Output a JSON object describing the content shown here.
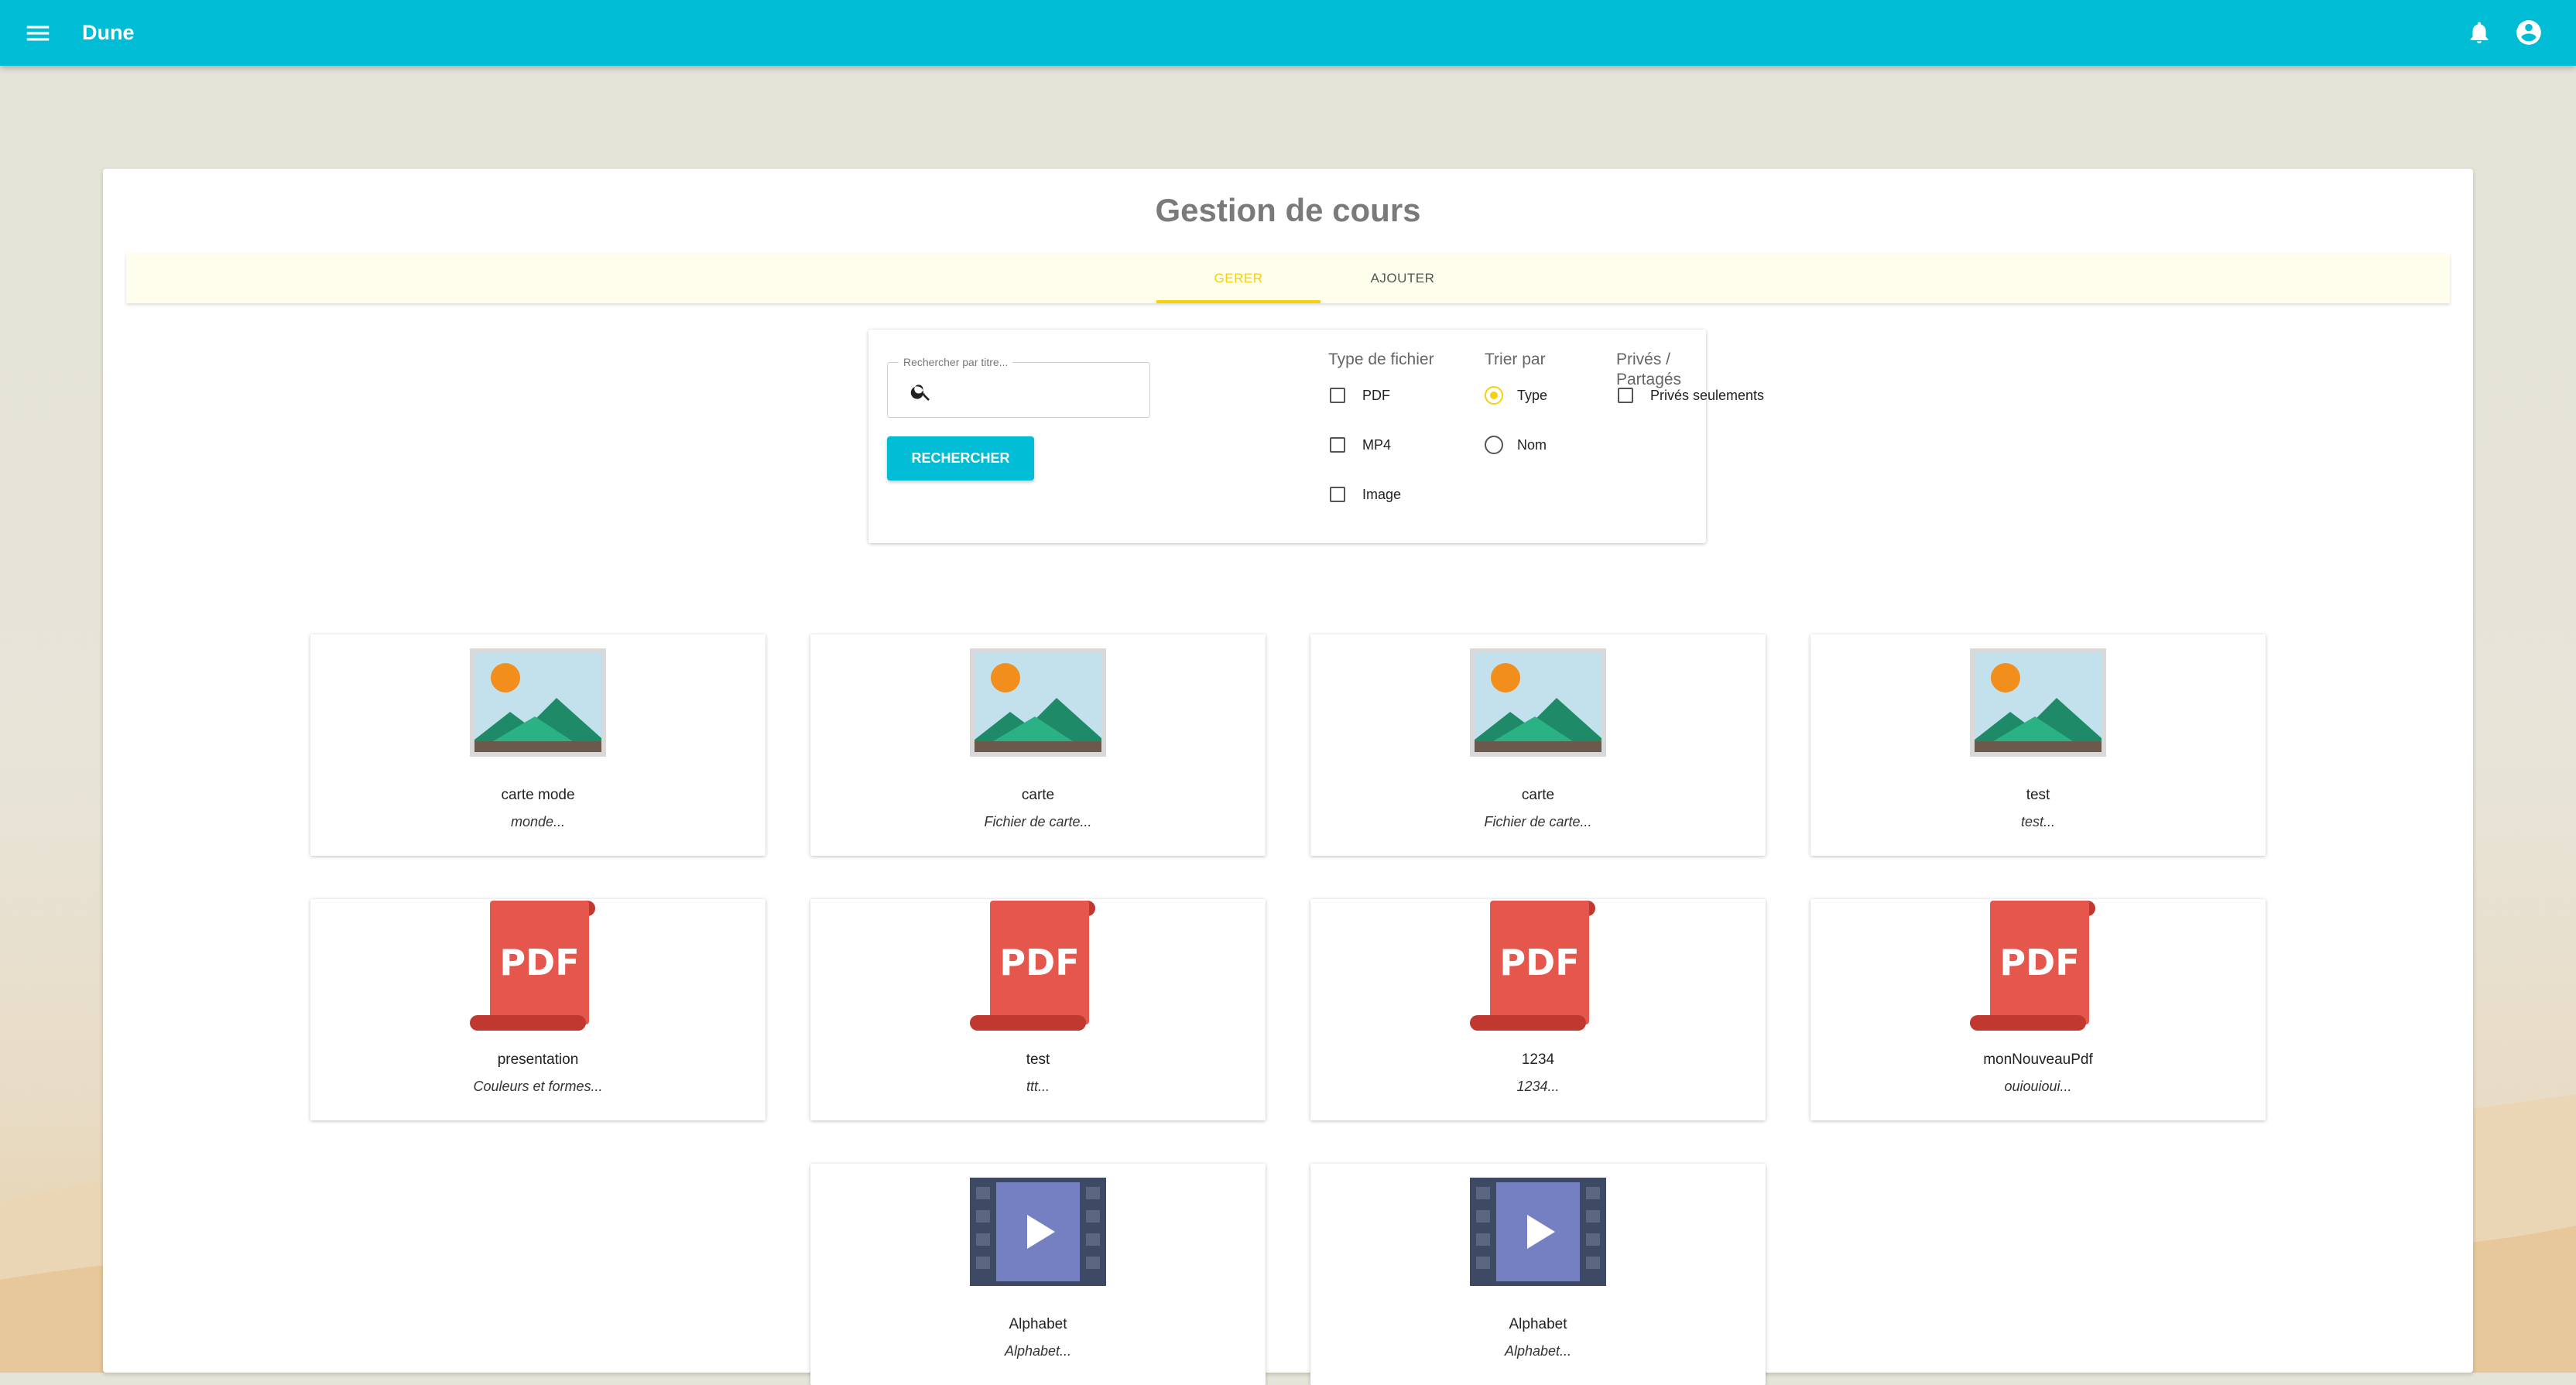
{
  "app": {
    "title": "Dune"
  },
  "page": {
    "title": "Gestion de cours"
  },
  "tabs": [
    {
      "label": "GERER",
      "active": true
    },
    {
      "label": "AJOUTER",
      "active": false
    }
  ],
  "filter": {
    "search_label": "Rechercher par titre...",
    "search_value": "",
    "search_button": "RECHERCHER",
    "file_type": {
      "title": "Type de fichier",
      "options": [
        {
          "label": "PDF",
          "checked": false
        },
        {
          "label": "MP4",
          "checked": false
        },
        {
          "label": "Image",
          "checked": false
        }
      ]
    },
    "sort": {
      "title": "Trier par",
      "options": [
        {
          "label": "Type",
          "selected": true
        },
        {
          "label": "Nom",
          "selected": false
        }
      ]
    },
    "sharing": {
      "title": "Privés / Partagés",
      "options": [
        {
          "label": "Privés seulements",
          "checked": false
        }
      ]
    }
  },
  "courses": [
    {
      "kind": "image",
      "icon": "image-file-icon",
      "title": "carte mode",
      "desc": "monde..."
    },
    {
      "kind": "image",
      "icon": "image-file-icon",
      "title": "carte",
      "desc": "Fichier de carte..."
    },
    {
      "kind": "image",
      "icon": "image-file-icon",
      "title": "carte",
      "desc": "Fichier de carte..."
    },
    {
      "kind": "image",
      "icon": "image-file-icon",
      "title": "test",
      "desc": "test..."
    },
    {
      "kind": "pdf",
      "icon": "pdf-file-icon",
      "title": "presentation",
      "desc": "Couleurs et formes..."
    },
    {
      "kind": "pdf",
      "icon": "pdf-file-icon",
      "title": "test",
      "desc": "ttt..."
    },
    {
      "kind": "pdf",
      "icon": "pdf-file-icon",
      "title": "1234",
      "desc": "1234..."
    },
    {
      "kind": "pdf",
      "icon": "pdf-file-icon",
      "title": "monNouveauPdf",
      "desc": "ouiouioui..."
    },
    {
      "kind": "video",
      "icon": "video-file-icon",
      "title": "Alphabet",
      "desc": "Alphabet..."
    },
    {
      "kind": "video",
      "icon": "video-file-icon",
      "title": "Alphabet",
      "desc": "Alphabet..."
    }
  ],
  "colors": {
    "appbar": "#00bcd4",
    "accent": "#f5d10c",
    "pdf": "#e5574c",
    "video": "#7480c2"
  },
  "icons": {
    "menu": "menu-icon",
    "notifications": "bell-icon",
    "account": "account-circle-icon",
    "search": "search-icon"
  }
}
